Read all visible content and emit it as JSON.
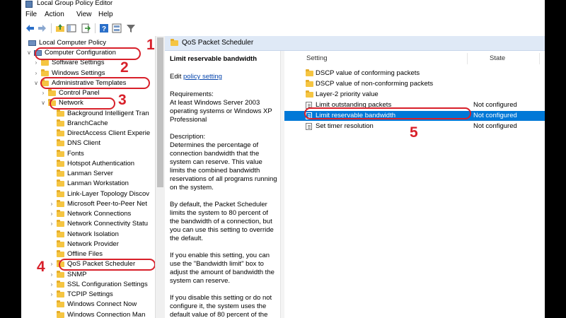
{
  "window": {
    "title": "Local Group Policy Editor"
  },
  "menu": [
    "File",
    "Action",
    "View",
    "Help"
  ],
  "tree": {
    "root": "Local Computer Policy",
    "items": [
      {
        "label": "Computer Configuration",
        "level": 1
      },
      {
        "label": "Software Settings",
        "level": 2
      },
      {
        "label": "Windows Settings",
        "level": 2
      },
      {
        "label": "Administrative Templates",
        "level": 2
      },
      {
        "label": "Control Panel",
        "level": 3
      },
      {
        "label": "Network",
        "level": 3
      },
      {
        "label": "Background Intelligent Tran",
        "level": 4
      },
      {
        "label": "BranchCache",
        "level": 4
      },
      {
        "label": "DirectAccess Client Experie",
        "level": 4
      },
      {
        "label": "DNS Client",
        "level": 4
      },
      {
        "label": "Fonts",
        "level": 4
      },
      {
        "label": "Hotspot Authentication",
        "level": 4
      },
      {
        "label": "Lanman Server",
        "level": 4
      },
      {
        "label": "Lanman Workstation",
        "level": 4
      },
      {
        "label": "Link-Layer Topology Discov",
        "level": 4
      },
      {
        "label": "Microsoft Peer-to-Peer Net",
        "level": 4
      },
      {
        "label": "Network Connections",
        "level": 4
      },
      {
        "label": "Network Connectivity Statu",
        "level": 4
      },
      {
        "label": "Network Isolation",
        "level": 4
      },
      {
        "label": "Network Provider",
        "level": 4
      },
      {
        "label": "Offline Files",
        "level": 4
      },
      {
        "label": "QoS Packet Scheduler",
        "level": 4
      },
      {
        "label": "SNMP",
        "level": 4
      },
      {
        "label": "SSL Configuration Settings",
        "level": 4
      },
      {
        "label": "TCPIP Settings",
        "level": 4
      },
      {
        "label": "Windows Connect Now",
        "level": 4
      },
      {
        "label": "Windows Connection Man",
        "level": 4
      }
    ]
  },
  "right": {
    "header": "QoS Packet Scheduler",
    "detail": {
      "title": "Limit reservable bandwidth",
      "edit_prefix": "Edit ",
      "edit_link": "policy setting",
      "requirements_label": "Requirements:",
      "requirements": "At least Windows Server 2003 operating systems or Windows XP Professional",
      "description_label": "Description:",
      "description_1": "Determines the percentage of connection bandwidth that the system can reserve. This value limits the combined bandwidth reservations of all programs running on the system.",
      "description_2": "By default, the Packet Scheduler limits the system to 80 percent of the bandwidth of a connection, but you can use this setting to override the default.",
      "description_3": "If you enable this setting, you can use the \"Bandwidth limit\" box to adjust the amount of bandwidth the system can reserve.",
      "description_4": "If you disable this setting or do not configure it, the system uses the default value of 80 percent of the"
    },
    "columns": {
      "setting": "Setting",
      "state": "State"
    },
    "rows": [
      {
        "name": "DSCP value of conforming packets",
        "state": "",
        "type": "folder"
      },
      {
        "name": "DSCP value of non-conforming packets",
        "state": "",
        "type": "folder"
      },
      {
        "name": "Layer-2 priority value",
        "state": "",
        "type": "folder"
      },
      {
        "name": "Limit outstanding packets",
        "state": "Not configured",
        "type": "setting"
      },
      {
        "name": "Limit reservable bandwidth",
        "state": "Not configured",
        "type": "setting",
        "selected": true
      },
      {
        "name": "Set timer resolution",
        "state": "Not configured",
        "type": "setting"
      }
    ]
  },
  "annotations": [
    "1",
    "2",
    "3",
    "4",
    "5"
  ],
  "colors": {
    "highlight": "#0078d7",
    "annotation": "#d8202a",
    "folder": "#f5c542"
  }
}
